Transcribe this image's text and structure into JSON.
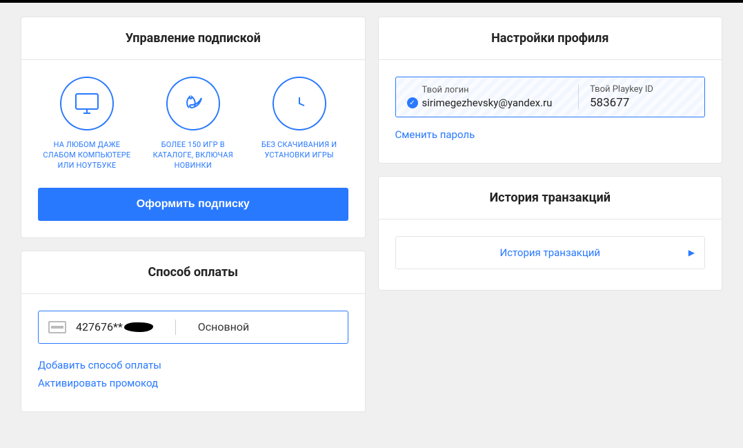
{
  "subscription": {
    "title": "Управление подпиской",
    "feature1": "НА ЛЮБОМ ДАЖЕ СЛАБОМ КОМПЬЮТЕРЕ ИЛИ НОУТБУКЕ",
    "feature2": "БОЛЕЕ 150 ИГР В КАТАЛОГЕ, ВКЛЮЧАЯ НОВИНКИ",
    "feature3": "БЕЗ СКАЧИВАНИЯ И УСТАНОВКИ ИГРЫ",
    "cta": "Оформить подписку"
  },
  "payment": {
    "title": "Способ оплаты",
    "masked_number": "427676**",
    "status": "Основной",
    "add_link": "Добавить способ оплаты",
    "promo_link": "Активировать промокод"
  },
  "profile": {
    "title": "Настройки профиля",
    "login_label": "Твой логин",
    "login_value": "sirimegezhevsky@yandex.ru",
    "id_label": "Твой Playkey ID",
    "id_value": "583677",
    "change_password": "Сменить пароль"
  },
  "history": {
    "title": "История транзакций",
    "button": "История транзакций"
  }
}
